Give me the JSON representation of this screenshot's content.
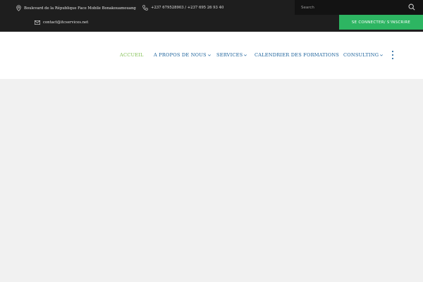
{
  "topbar": {
    "address": "Boulevard de la République Face Mobile Bonakouamouang",
    "address_icon": "map-pin-icon",
    "phone": "+237 679528903 / +237 695 26 93 40",
    "phone_icon": "phone-icon",
    "email": "contact@itcservices.net",
    "email_icon": "envelope-icon",
    "search": {
      "placeholder": "Search",
      "value": "",
      "icon": "search-icon"
    },
    "login_label": "SE CONNECTER/ S'INSCRIRE"
  },
  "nav": {
    "items": [
      {
        "label": "ACCUEIL",
        "active": true
      },
      {
        "label": "A PROPOS DE NOUS",
        "dropdown": true
      },
      {
        "label": "SERVICES",
        "dropdown": true
      },
      {
        "label": "CALENDRIER DES FORMATIONS"
      },
      {
        "label": "CONSULTING",
        "dropdown": true
      }
    ],
    "more_icon": "vertical-dots-icon"
  },
  "colors": {
    "topbar_bg": "#1e1e1e",
    "accent_green": "#2db562",
    "nav_blue": "#19609a",
    "nav_active": "#7fbf50",
    "content_bg": "#f1f1f1"
  }
}
